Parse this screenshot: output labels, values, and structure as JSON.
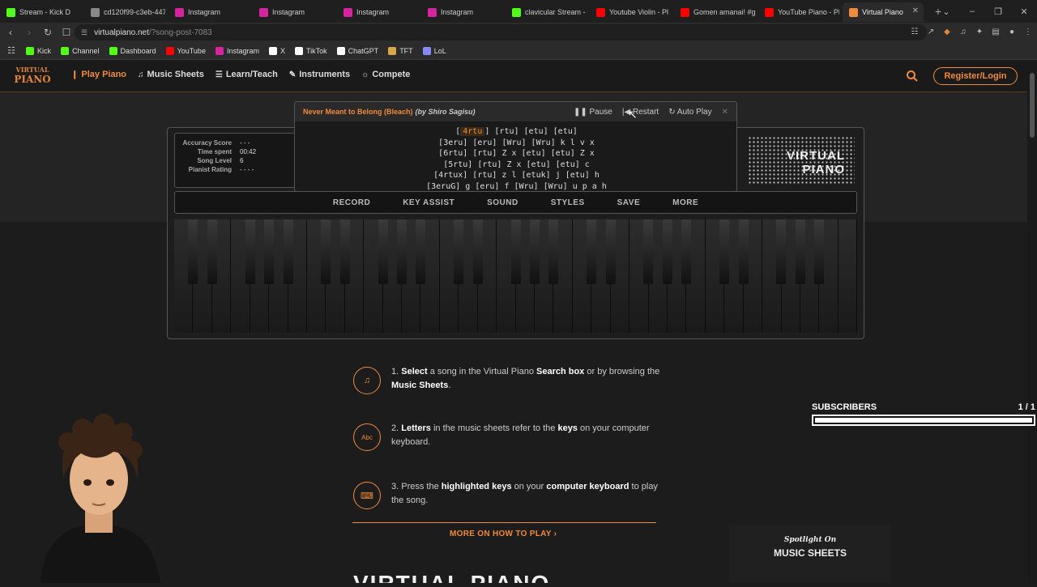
{
  "browser": {
    "tabs": [
      {
        "label": "Stream - Kick D",
        "icon": "kick-icon",
        "color": "#53fc18"
      },
      {
        "label": "cd120f99-c3eb-447",
        "icon": "globe-icon",
        "color": "#888888"
      },
      {
        "label": "Instagram",
        "icon": "instagram-icon",
        "color": "#d6249f"
      },
      {
        "label": "Instagram",
        "icon": "instagram-icon",
        "color": "#d6249f"
      },
      {
        "label": "Instagram",
        "icon": "instagram-icon",
        "color": "#d6249f"
      },
      {
        "label": "Instagram",
        "icon": "instagram-icon",
        "color": "#d6249f"
      },
      {
        "label": "clavicular Stream - V",
        "icon": "kick-icon",
        "color": "#53fc18"
      },
      {
        "label": "Youtube Violin - Pl",
        "icon": "youtube-icon",
        "color": "#ff0000"
      },
      {
        "label": "Gomen amanai! #g",
        "icon": "youtube-icon",
        "color": "#ff0000"
      },
      {
        "label": "YouTube Piano - Pl",
        "icon": "youtube-icon",
        "color": "#ff0000"
      },
      {
        "label": "Virtual Piano",
        "icon": "virtualpiano-icon",
        "color": "#f08a3c",
        "active": true
      }
    ],
    "url_host": "virtualpiano.net",
    "url_path": "/?song-post-7083",
    "bookmarks": [
      {
        "label": "Kick",
        "icon": "kick-icon",
        "color": "#53fc18"
      },
      {
        "label": "Channel",
        "icon": "kick-icon",
        "color": "#53fc18"
      },
      {
        "label": "Dashboard",
        "icon": "kick-icon",
        "color": "#53fc18"
      },
      {
        "label": "YouTube",
        "icon": "youtube-icon",
        "color": "#ff0000"
      },
      {
        "label": "Instagram",
        "icon": "instagram-icon",
        "color": "#d6249f"
      },
      {
        "label": "X",
        "icon": "x-icon",
        "color": "#ffffff"
      },
      {
        "label": "TikTok",
        "icon": "tiktok-icon",
        "color": "#ffffff"
      },
      {
        "label": "ChatGPT",
        "icon": "chatgpt-icon",
        "color": "#ffffff"
      },
      {
        "label": "TFT",
        "icon": "tft-icon",
        "color": "#d4a84a"
      },
      {
        "label": "LoL",
        "icon": "lol-icon",
        "color": "#8888ff"
      }
    ]
  },
  "site": {
    "accent": "#f08a3c",
    "logo": {
      "line1": "VIRTUAL",
      "line2": "PIANO"
    },
    "nav": [
      {
        "label": "Play Piano",
        "icon": "piano-icon",
        "active": true
      },
      {
        "label": "Music Sheets",
        "icon": "music-note-icon"
      },
      {
        "label": "Learn/Teach",
        "icon": "teach-icon"
      },
      {
        "label": "Instruments",
        "icon": "guitar-icon"
      },
      {
        "label": "Compete",
        "icon": "trophy-icon"
      }
    ],
    "register_label": "Register/Login"
  },
  "stats": [
    {
      "label": "Accuracy Score",
      "value": "- - -"
    },
    {
      "label": "Time spent",
      "value": "00:42"
    },
    {
      "label": "Song Level",
      "value": "6"
    },
    {
      "label": "Pianist Rating",
      "value": "- - - -"
    }
  ],
  "watermark": "VIRTUAL PIANO",
  "toolbar": [
    "RECORD",
    "KEY ASSIST",
    "SOUND",
    "STYLES",
    "SAVE",
    "MORE"
  ],
  "sheet": {
    "title": "Never Meant to Belong (Bleach)",
    "author": "(by Shiro Sagisu)",
    "pause_label": "Pause",
    "restart_label": "Restart",
    "autoplay_label": "Auto Play",
    "highlight": "4rtu",
    "lines": [
      "[3eru] [eru] [Wru] [Wru] k l v x",
      "[6rtu] [rtu] Z x [etu] [etu] Z x",
      "[5rtu] [rtu] Z x [etu] [etu] c",
      "[4rtux] [rtu] z l [etuk] j [etu] h",
      "[3eruG] g [eru] f [Wru] [Wru] u p a h"
    ],
    "first_line_rest": "[rtu] [etu] [etu]"
  },
  "instructions": [
    {
      "icon": "music-note-icon",
      "pre": "1. ",
      "b1": "Select",
      "m1": " a song in the Virtual Piano ",
      "b2": "Search box",
      "m2": " or by browsing the ",
      "b3": "Music Sheets",
      "m3": "."
    },
    {
      "icon": "letters-icon",
      "pre": "2. ",
      "b1": "Letters",
      "m1": " in the music sheets refer to the ",
      "b2": "keys",
      "m2": " on your computer keyboard.",
      "b3": "",
      "m3": ""
    },
    {
      "icon": "keyboard-icon",
      "pre": "3. Press the ",
      "b1": "highlighted keys",
      "m1": " on your ",
      "b2": "computer keyboard",
      "m2": " to play the song.",
      "b3": "",
      "m3": ""
    }
  ],
  "more_link": "MORE ON HOW TO PLAY",
  "spotlight": {
    "small": "Spotlight On",
    "big": "MUSIC SHEETS"
  },
  "bottom_title": "VIRTUAL PIANO",
  "subscribers": {
    "label": "SUBSCRIBERS",
    "count": "1 / 1",
    "progress": 1.0
  }
}
